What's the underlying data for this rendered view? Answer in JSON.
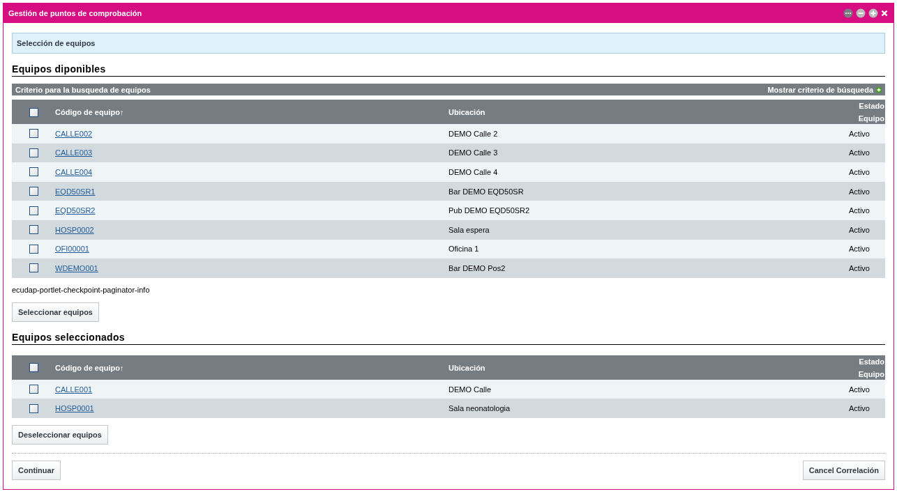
{
  "window": {
    "title": "Gestión de puntos de comprobación"
  },
  "info_box": "Selección de equipos",
  "available": {
    "heading": "Equipos diponibles",
    "criteria_bar": {
      "title": "Criterio para la busqueda de equipos",
      "toggle": "Mostrar criterio de búsqueda"
    },
    "table": {
      "select_all": {
        "checked": false
      },
      "columns": [
        "Código de equipo↑",
        "Ubicación",
        "Estado Equipo"
      ],
      "rows": [
        {
          "checked": false,
          "code": "CALLE002",
          "location": "DEMO Calle 2",
          "status": "Activo"
        },
        {
          "checked": false,
          "code": "CALLE003",
          "location": "DEMO Calle 3",
          "status": "Activo"
        },
        {
          "checked": false,
          "code": "CALLE004",
          "location": "DEMO Calle 4",
          "status": "Activo"
        },
        {
          "checked": false,
          "code": "EQD50SR1",
          "location": "Bar DEMO EQD50SR",
          "status": "Activo"
        },
        {
          "checked": false,
          "code": "EQD50SR2",
          "location": "Pub DEMO EQD50SR2",
          "status": "Activo"
        },
        {
          "checked": false,
          "code": "HOSP0002",
          "location": "Sala espera",
          "status": "Activo"
        },
        {
          "checked": false,
          "code": "OFI00001",
          "location": "Oficina 1",
          "status": "Activo"
        },
        {
          "checked": false,
          "code": "WDEMO001",
          "location": "Bar DEMO Pos2",
          "status": "Activo"
        }
      ]
    },
    "paginator": "ecudap-portlet-checkpoint-paginator-info",
    "button": "Seleccionar equipos"
  },
  "selected": {
    "heading": "Equipos seleccionados",
    "table": {
      "select_all": {
        "checked": false
      },
      "columns": [
        "Código de equipo↑",
        "Ubicación",
        "Estado Equipo"
      ],
      "rows": [
        {
          "checked": false,
          "code": "CALLE001",
          "location": "DEMO Calle",
          "status": "Activo"
        },
        {
          "checked": false,
          "code": "HOSP0001",
          "location": "Sala neonatologia",
          "status": "Activo"
        }
      ]
    },
    "button": "Deseleccionar equipos"
  },
  "footer": {
    "continue": "Continuar",
    "cancel": "Cancel Correlación"
  }
}
